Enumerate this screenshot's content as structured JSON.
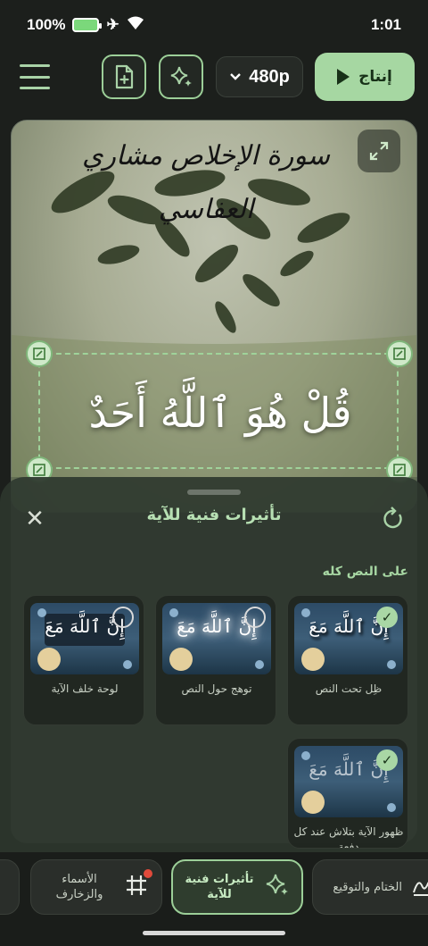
{
  "status_bar": {
    "battery": "100%",
    "time": "1:01"
  },
  "toolbar": {
    "resolution": "480p",
    "produce_label": "إنتاج"
  },
  "preview": {
    "sura_title": "سورة الإخلاص مشاري العفاسي",
    "verse_text": "قُلْ هُوَ ٱللَّهُ أَحَدٌ"
  },
  "sheet": {
    "title": "تأثيرات فنية للآية",
    "section_label": "على النص كله",
    "cards": [
      {
        "label": "ظِل تحت النص",
        "thumb_text": "إِنَّ ٱللَّهَ مَعَ",
        "selected": true
      },
      {
        "label": "توهج حول النص",
        "thumb_text": "إِنَّ ٱللَّهَ مَعَ",
        "selected": false
      },
      {
        "label": "لوحة خلف الآية",
        "thumb_text": "إِنَّ ٱللَّهَ مَعَ",
        "selected": false
      },
      {
        "label": "ظهور الآية بتلاش عند كل دفعة",
        "thumb_text": "إِنَّ ٱللَّهَ مَعَ",
        "selected": true
      }
    ]
  },
  "bottom_nav": {
    "items": [
      {
        "label": "الختام والتوقيع"
      },
      {
        "label": "تأثيرات فنية للآية"
      },
      {
        "label": "الأسماء والزخارف"
      }
    ]
  },
  "colors": {
    "accent": "#a6d7a2",
    "sheet": "#2c362c",
    "thumb": "#2d4b66"
  }
}
